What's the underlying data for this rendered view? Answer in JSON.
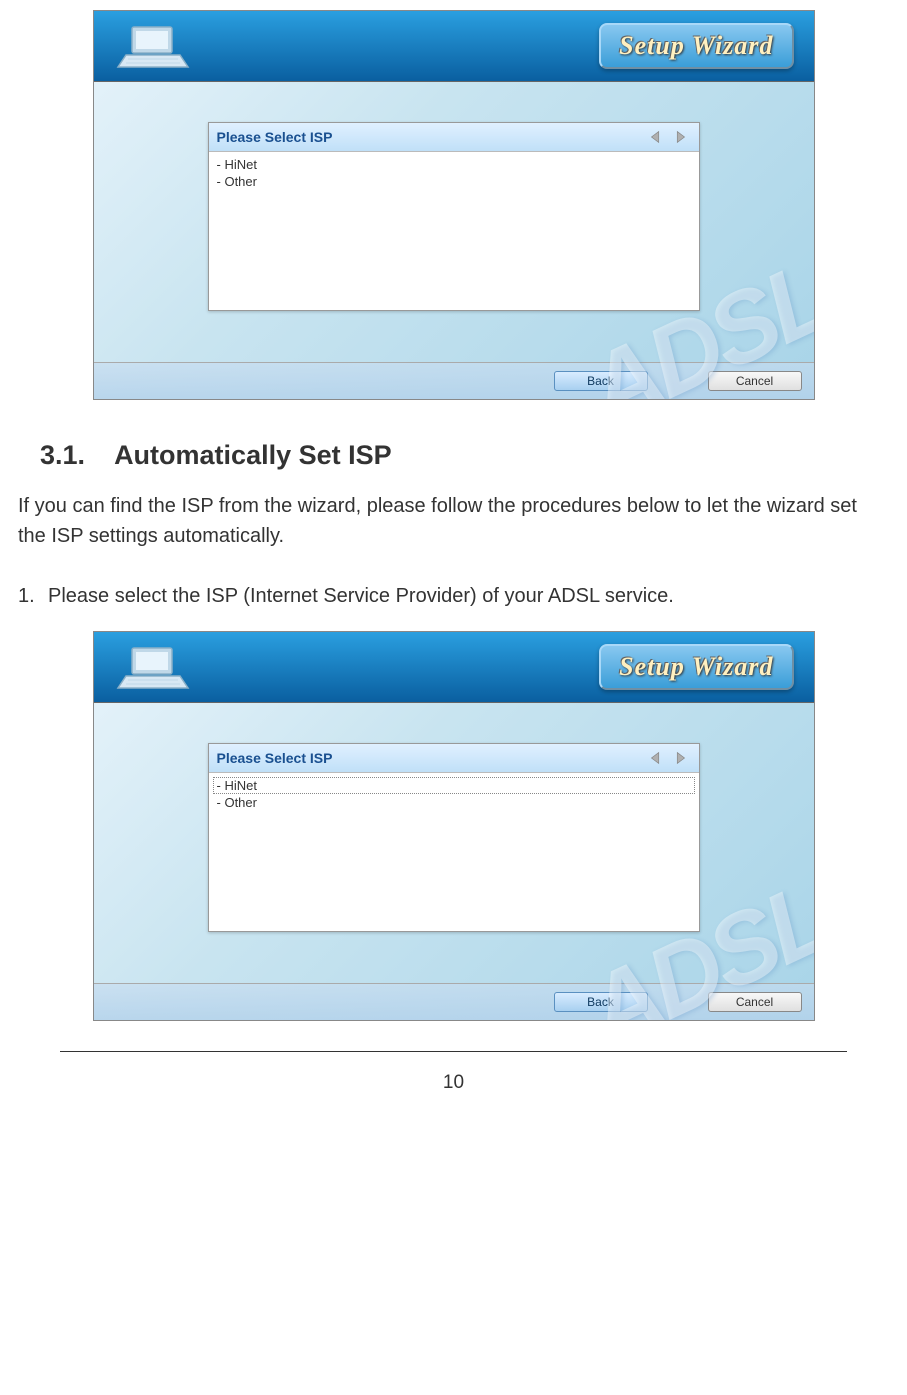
{
  "wizard": {
    "title": "Setup Wizard",
    "panel_label": "Please Select ISP",
    "isp_items": [
      "HiNet",
      "Other"
    ],
    "back_label": "Back",
    "cancel_label": "Cancel",
    "watermark": "ADSL"
  },
  "section": {
    "number": "3.1.",
    "title": "Automatically Set ISP",
    "intro": "If you can find the ISP from the wizard, please follow the procedures below to let the wizard set the ISP settings automatically.",
    "step1_num": "1.",
    "step1": "Please select the ISP (Internet Service Provider) of your ADSL service."
  },
  "page_number": "10"
}
